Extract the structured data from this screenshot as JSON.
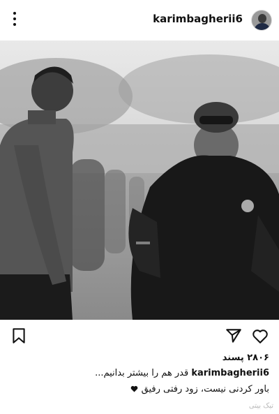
{
  "header": {
    "username": "karimbagherii6",
    "menu_icon": "more-vertical-icon",
    "avatar_icon": "profile-avatar"
  },
  "post": {
    "photo_description_icon": "post-photo",
    "likes_text": "۲۸۰۶ پسند",
    "caption": {
      "username": "karimbagherii6",
      "line1_text": "قدر هم را بیشتر بدانیم...",
      "line2_text": "باور کردنی نیست، زود رفتی رفیق"
    },
    "watermark": "تیک بیتی"
  },
  "actions": {
    "like_icon": "heart-icon",
    "share_icon": "send-icon",
    "save_icon": "bookmark-icon"
  }
}
